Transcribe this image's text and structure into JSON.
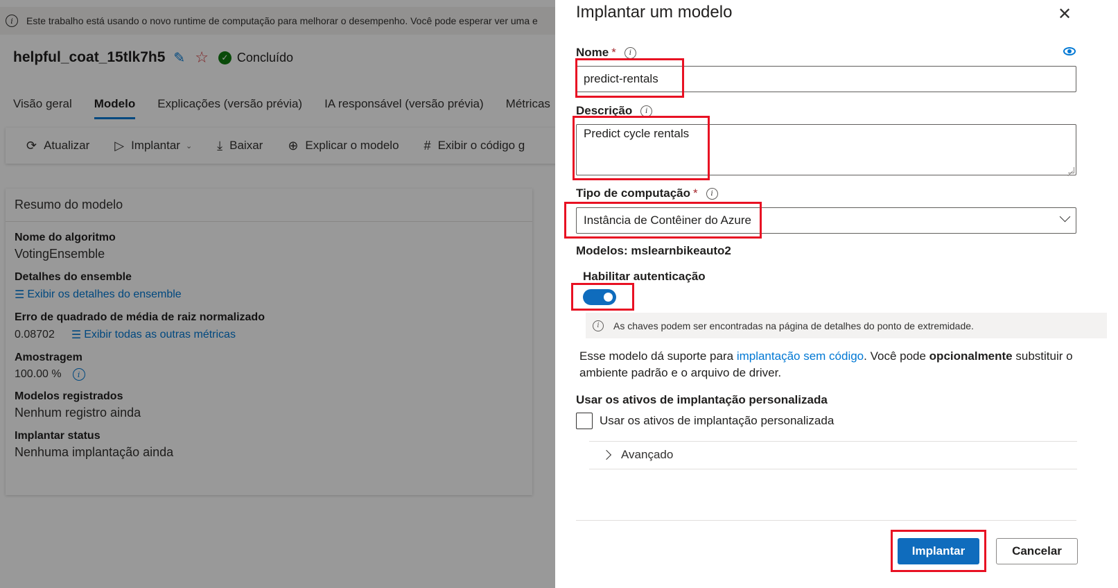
{
  "background": {
    "info_banner": "Este trabalho está usando o novo runtime de computação para melhorar o desempenho. Você pode esperar ver uma e",
    "run": {
      "title": "helpful_coat_15tlk7h5",
      "status": "Concluído"
    },
    "tabs": [
      {
        "label": "Visão geral"
      },
      {
        "label": "Modelo"
      },
      {
        "label": "Explicações (versão prévia)"
      },
      {
        "label": "IA responsável (versão prévia)"
      },
      {
        "label": "Métricas"
      }
    ],
    "toolbar": {
      "refresh": "Atualizar",
      "deploy": "Implantar",
      "download": "Baixar",
      "explain": "Explicar o modelo",
      "view_code": "Exibir o código g"
    },
    "summary": {
      "heading": "Resumo do modelo",
      "algorithm_label": "Nome do algoritmo",
      "algorithm_value": "VotingEnsemble",
      "ensemble_label": "Detalhes do ensemble",
      "ensemble_link": "Exibir os detalhes do ensemble",
      "metric_label": "Erro de quadrado de média de raiz normalizado",
      "metric_value": "0.08702",
      "metric_link": "Exibir todas as outras métricas",
      "sampling_label": "Amostragem",
      "sampling_value": "100.00 %",
      "registered_label": "Modelos registrados",
      "registered_value": "Nenhum registro ainda",
      "deploy_label": "Implantar status",
      "deploy_value": "Nenhuma implantação ainda"
    }
  },
  "panel": {
    "title": "Implantar um modelo",
    "name_label": "Nome",
    "name_value": "predict-rentals",
    "description_label": "Descrição",
    "description_value": "Predict cycle rentals",
    "compute_label": "Tipo de computação",
    "compute_value": "Instância de Contêiner do Azure",
    "models_line": "Modelos: mslearnbikeauto2",
    "auth_label": "Habilitar autenticação",
    "auth_enabled": true,
    "auth_message": "As chaves podem ser encontradas na página de detalhes do ponto de extremidade.",
    "support_text_1": "Esse modelo dá suporte para ",
    "support_link": "implantação sem código",
    "support_text_2": ". Você pode ",
    "support_bold": "opcionalmente",
    "support_text_3": " substituir o ambiente padrão e o arquivo de driver.",
    "custom_assets_heading": "Usar os ativos de implantação personalizada",
    "custom_assets_checkbox": "Usar os ativos de implantação personalizada",
    "custom_assets_checked": false,
    "advanced_label": "Avançado",
    "deploy_button": "Implantar",
    "cancel_button": "Cancelar"
  },
  "colors": {
    "accent": "#0f6cbd",
    "highlight": "#e81123",
    "success": "#107c10",
    "required": "#a4262c"
  }
}
